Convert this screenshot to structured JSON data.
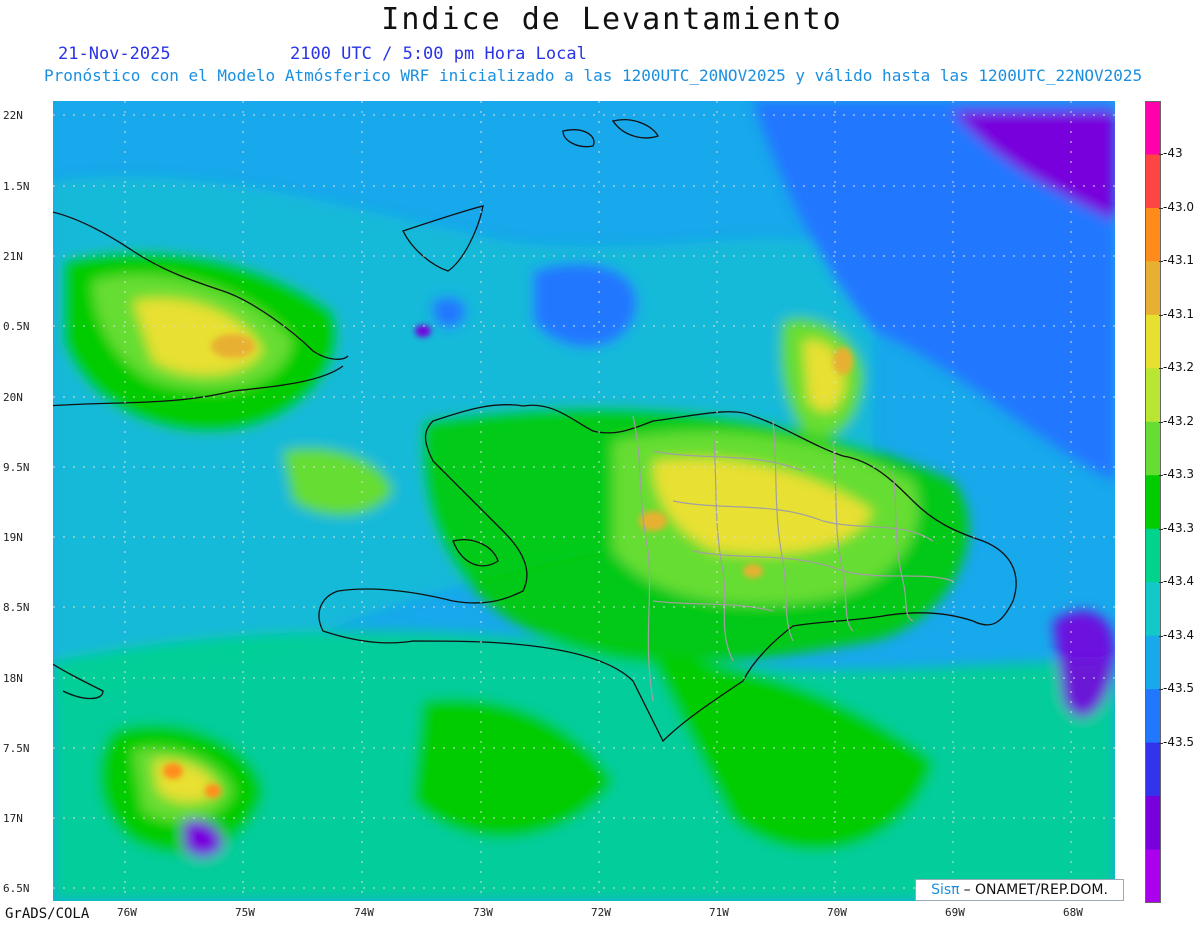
{
  "header": {
    "title": "Indice de Levantamiento",
    "date": "21-Nov-2025",
    "time": "2100 UTC / 5:00 pm Hora Local",
    "forecast_line": "Pronóstico con el Modelo Atmósferico WRF inicializado a las 1200UTC_20NOV2025 y válido hasta las  1200UTC_22NOV2025"
  },
  "map": {
    "lat_labels": [
      "22N",
      "1.5N",
      "21N",
      "0.5N",
      "20N",
      "9.5N",
      "19N",
      "8.5N",
      "18N",
      "7.5N",
      "17N",
      "6.5N"
    ],
    "lon_labels": [
      "76W",
      "75W",
      "74W",
      "73W",
      "72W",
      "71W",
      "70W",
      "69W",
      "68W"
    ],
    "background_color": "#18a8ec"
  },
  "colorbar": {
    "labels": [
      "-43",
      "-43.0",
      "-43.1",
      "-43.1",
      "-43.2",
      "-43.2",
      "-43.3",
      "-43.3",
      "-43.4",
      "-43.4",
      "-43.5",
      "-43.5"
    ],
    "colors": [
      "#ff00aa",
      "#ff4444",
      "#ff8c1a",
      "#e8b030",
      "#e8e030",
      "#b8e632",
      "#66dd33",
      "#00cc00",
      "#00d48c",
      "#12c8c8",
      "#18a8ec",
      "#2277ff",
      "#3333ee",
      "#7700dd",
      "#aa00ee"
    ]
  },
  "footer": {
    "software": "GrADS/COLA",
    "credit_brand": "Sisπ",
    "credit_text": "–  ONAMET/REP.DOM."
  }
}
